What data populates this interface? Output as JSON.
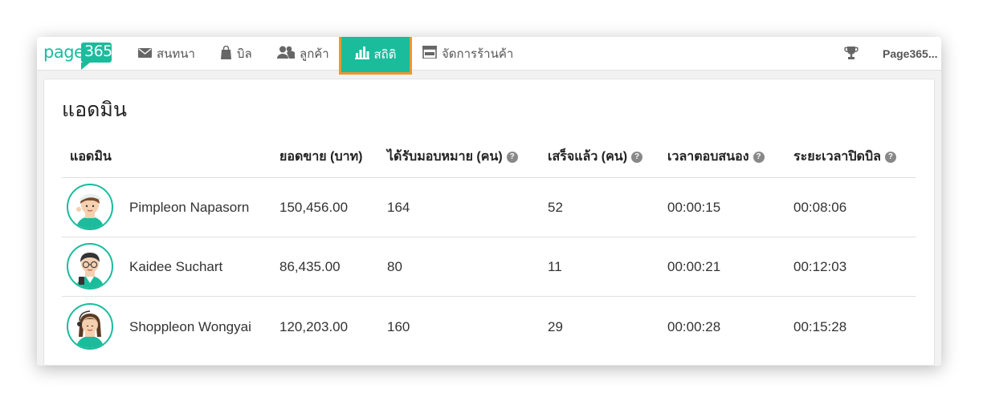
{
  "navbar": {
    "logo_page": "page",
    "logo_num": "365",
    "items": [
      {
        "label": "สนทนา",
        "icon": "envelope-icon"
      },
      {
        "label": "บิล",
        "icon": "shopping-bag-icon"
      },
      {
        "label": "ลูกค้า",
        "icon": "users-icon"
      },
      {
        "label": "สถิติ",
        "icon": "bar-chart-icon",
        "active": true
      },
      {
        "label": "จัดการร้านค้า",
        "icon": "store-icon"
      }
    ],
    "trophy_icon": "trophy-icon",
    "user": "Page365..."
  },
  "page": {
    "title": "แอดมิน"
  },
  "table": {
    "headers": [
      "แอดมิน",
      "ยอดขาย (บาท)",
      "ได้รับมอบหมาย (คน)",
      "เสร็จแล้ว (คน)",
      "เวลาตอบสนอง",
      "ระยะเวลาปิดบิล"
    ],
    "help_icon": "?",
    "rows": [
      {
        "name": "Pimpleon Napasorn",
        "sales": "150,456.00",
        "assigned": "164",
        "done": "52",
        "response": "00:00:15",
        "close": "00:08:06"
      },
      {
        "name": "Kaidee Suchart",
        "sales": "86,435.00",
        "assigned": "80",
        "done": "11",
        "response": "00:00:21",
        "close": "00:12:03"
      },
      {
        "name": "Shoppleon Wongyai",
        "sales": "120,203.00",
        "assigned": "160",
        "done": "29",
        "response": "00:00:28",
        "close": "00:15:28"
      }
    ]
  },
  "colors": {
    "brand": "#1abc9c",
    "active_border": "#f0962f"
  }
}
